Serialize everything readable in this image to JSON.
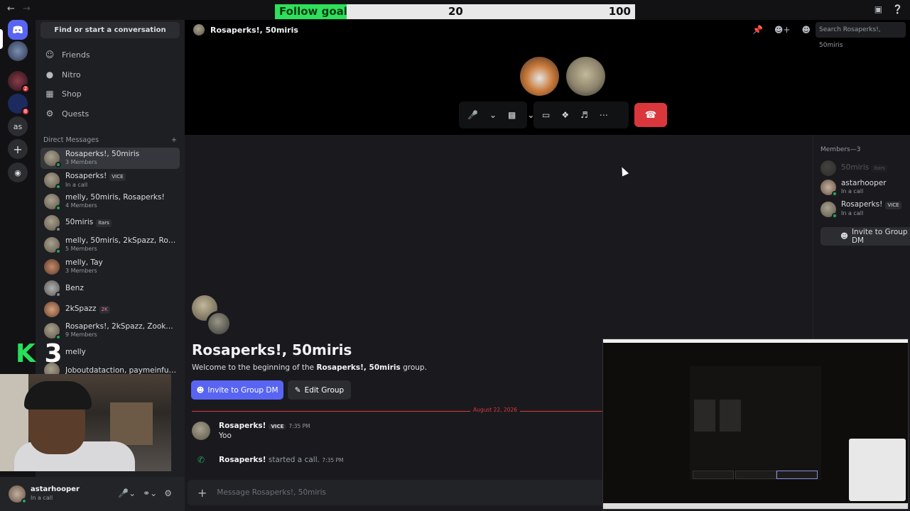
{
  "follow_goal": {
    "label": "Follow goal",
    "current": "20",
    "target": "100",
    "progress_fraction": 0.2,
    "fill_color": "#2ee05b"
  },
  "titlebar": {
    "back_icon": "arrow-left-icon",
    "forward_icon": "arrow-right-icon",
    "right_icons": [
      "inbox-icon",
      "help-icon"
    ]
  },
  "servers": [
    {
      "name": "discord-home",
      "icon": "discord-logo-icon"
    },
    {
      "name": "server-1",
      "badge": ""
    },
    {
      "name": "server-2",
      "badge": "2"
    },
    {
      "name": "server-3",
      "badge": "8"
    },
    {
      "name": "server-as",
      "label": "as"
    },
    {
      "name": "add-server",
      "icon": "plus-icon"
    },
    {
      "name": "explore",
      "icon": "compass-icon"
    }
  ],
  "sidebar": {
    "search_label": "Find or start a conversation",
    "nav": [
      {
        "label": "Friends",
        "icon": "friends-icon"
      },
      {
        "label": "Nitro",
        "icon": "nitro-icon"
      },
      {
        "label": "Shop",
        "icon": "shop-icon"
      },
      {
        "label": "Quests",
        "icon": "quests-icon"
      }
    ],
    "dm_header": "Direct Messages",
    "dms": [
      {
        "name": "Rosaperks!, 50miris",
        "sub": "3 Members",
        "active": true
      },
      {
        "name": "Rosaperks!",
        "tag": "VICE",
        "sub": "In a call"
      },
      {
        "name": "melly, 50miris, Rosaperks!",
        "sub": "4 Members"
      },
      {
        "name": "50miris",
        "tag": "itars",
        "sub": ""
      },
      {
        "name": "melly, 50miris, 2kSpazz, Rosape...",
        "sub": "5 Members"
      },
      {
        "name": "melly, Tay",
        "sub": "3 Members"
      },
      {
        "name": "Benz",
        "sub": ""
      },
      {
        "name": "2kSpazz",
        "tag": "2K",
        "sub": ""
      },
      {
        "name": "Rosaperks!, 2kSpazz, Zooka, Ko...",
        "sub": "9 Members"
      },
      {
        "name": "melly",
        "sub": ""
      },
      {
        "name": "Joboutdataction, paymeinfull, ...",
        "sub": ""
      }
    ]
  },
  "overlay": {
    "logo_k": "K",
    "logo_3": "3"
  },
  "user_panel": {
    "name": "astarhooper",
    "status": "In a call"
  },
  "channel": {
    "title": "Rosaperks!, 50miris",
    "search_placeholder": "Search Rosaperks!, 50miris",
    "header_icons": [
      "pin-icon",
      "add-member-icon",
      "members-icon"
    ]
  },
  "call_controls": {
    "group1": [
      "mic-icon",
      "chevron-down-icon",
      "camera-off-icon",
      "chevron-down-icon"
    ],
    "group2": [
      "screen-share-icon",
      "activities-icon",
      "soundboard-icon",
      "more-icon"
    ],
    "hangup_icon": "hang-up-icon"
  },
  "members": {
    "header": "Members—3",
    "list": [
      {
        "name": "50miris",
        "tag": "itars",
        "sub": "",
        "dim": true
      },
      {
        "name": "astarhooper",
        "sub": "In a call"
      },
      {
        "name": "Rosaperks!",
        "tag": "VICE",
        "sub": "In a call"
      }
    ],
    "invite_label": "Invite to Group DM"
  },
  "welcome": {
    "title": "Rosaperks!, 50miris",
    "sub_prefix": "Welcome to the beginning of the ",
    "sub_bold": "Rosaperks!, 50miris",
    "sub_suffix": " group.",
    "invite_button": "Invite to Group DM",
    "edit_button": "Edit Group"
  },
  "divider_date": "August 22, 2026",
  "messages": [
    {
      "author": "Rosaperks!",
      "tag": "VICE",
      "time": "7:35 PM",
      "text": "Yoo"
    }
  ],
  "system_message": {
    "author": "Rosaperks!",
    "action": " started a call.",
    "time": "7:35 PM"
  },
  "composer": {
    "placeholder": "Message Rosaperks!, 50miris"
  }
}
